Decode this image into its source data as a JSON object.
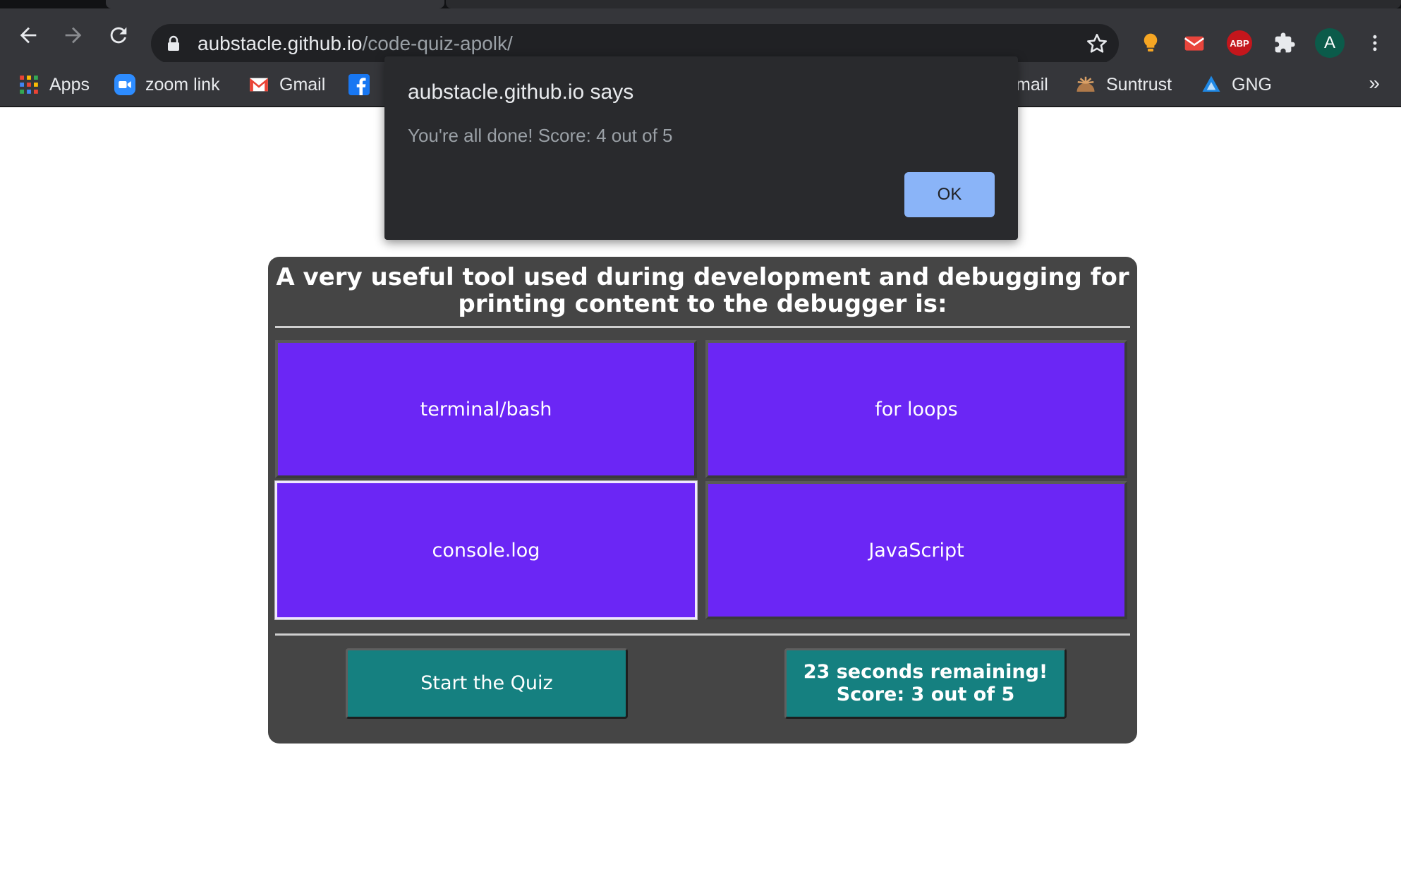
{
  "browser": {
    "url_host": "aubstacle.github.io",
    "url_path": "/code-quiz-apolk/",
    "bookmarks": [
      {
        "label": "Apps",
        "icon": "apps-grid-icon"
      },
      {
        "label": "zoom link",
        "icon": "zoom-icon"
      },
      {
        "label": "Gmail",
        "icon": "gmail-icon"
      },
      {
        "label": "",
        "icon": "facebook-icon"
      },
      {
        "label": "mail",
        "icon": ""
      },
      {
        "label": "Suntrust",
        "icon": "suntrust-icon"
      },
      {
        "label": "GNG",
        "icon": "gng-icon"
      }
    ],
    "bookmarks_more": "»",
    "extensions": [
      {
        "name": "bulb-icon"
      },
      {
        "name": "mail-extension-icon"
      },
      {
        "name": "adblock-icon",
        "label": "ABP"
      },
      {
        "name": "puzzle-icon"
      }
    ],
    "avatar_letter": "A"
  },
  "alert": {
    "title": "aubstacle.github.io says",
    "message": "You're all done! Score: 4 out of 5",
    "ok_label": "OK"
  },
  "quiz": {
    "question": "A very useful tool used during development and debugging for printing content to the debugger is:",
    "answers": [
      "terminal/bash",
      "for loops",
      "console.log",
      "JavaScript"
    ],
    "start_label": "Start the Quiz",
    "timer_text": "23 seconds remaining!",
    "score_text": "Score: 3 out of 5"
  },
  "colors": {
    "answer_bg": "#6b26f5",
    "button_bg": "#158080",
    "panel_bg": "#454545",
    "ok_button": "#8ab4f8"
  }
}
